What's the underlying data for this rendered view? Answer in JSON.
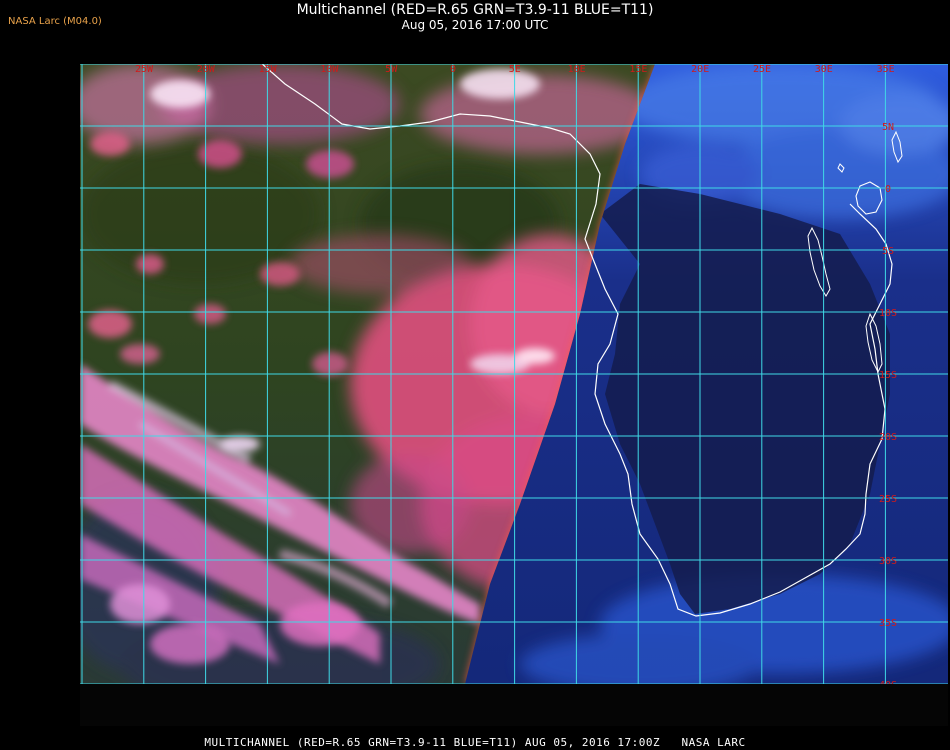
{
  "header": {
    "org": "NASA Larc (M04.0)",
    "title": "Multichannel (RED=R.65 GRN=T3.9-11 BLUE=T11)",
    "subtitle": "Aug 05, 2016 17:00 UTC"
  },
  "footer": {
    "text": "MULTICHANNEL (RED=R.65 GRN=T3.9-11 BLUE=T11) AUG 05, 2016 17:00Z   NASA LARC"
  },
  "map": {
    "lon_labels": [
      "25W",
      "20W",
      "15W",
      "10W",
      "5W",
      "0",
      "5E",
      "10E",
      "15E",
      "20E",
      "25E",
      "30E",
      "35E"
    ],
    "lat_labels": [
      "5N",
      "0",
      "5S",
      "10S",
      "15S",
      "20S",
      "25S",
      "30S",
      "35S",
      "40S"
    ],
    "colors": {
      "grid": "#3fd9e6",
      "label": "#d11a1a",
      "coast": "#ffffff",
      "land": "#16205a",
      "ocean_dark": "#0b1a4e",
      "day_ocean": "#2e4420",
      "day_cloud": "#ff5fa0",
      "night_cloud": "#4a78e8"
    }
  }
}
